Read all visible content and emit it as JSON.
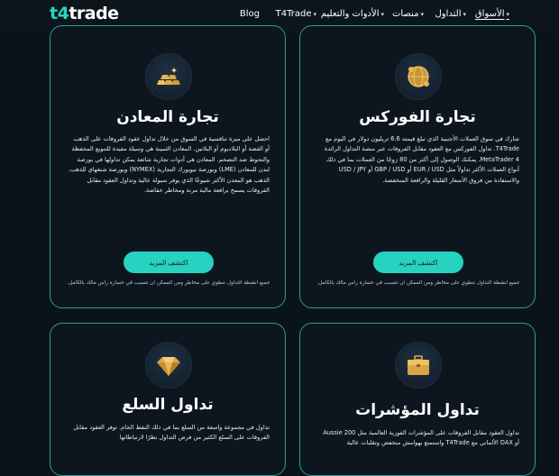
{
  "brand": {
    "logo_prefix": "t4",
    "logo_suffix": "trade"
  },
  "nav": {
    "items": [
      {
        "label": "الأسواق",
        "has_caret": true,
        "active": true
      },
      {
        "label": "التداول",
        "has_caret": true,
        "active": false
      },
      {
        "label": "منصات",
        "has_caret": true,
        "active": false
      },
      {
        "label": "الأدوات والتعليم",
        "has_caret": true,
        "active": false
      },
      {
        "label": "T4Trade",
        "has_caret": true,
        "active": false
      },
      {
        "label": "Blog",
        "has_caret": false,
        "active": false
      }
    ]
  },
  "cards": {
    "forex": {
      "icon": "globe-coins-icon",
      "title": "تجارة الفوركس",
      "description": "شارك في سوق العملات الأجنبية الذي تبلغ قيمته 6.6 تريليون دولار في اليوم مع T4Trade. تداول الفوركس مع العقود مقابل الفروقات عبر منصة التداول الرائدة MetaTrader 4. يمكنك الوصول إلى أكثر من 80 زوجًا من العملات بما في ذلك أنواع العملات الأكثر تداولاً مثل EUR / USD أو GBP / USD أو USD / JPY والاستفادة من فروق الأسعار القليلة والرافعة المنخفضة.",
      "button": "اكتشف المزيد",
      "risk": "جميع أنشطة التداول تنطوي على مخاطر ومن الممكن أن تتسبب في خسارة رأس مالك بالكامل."
    },
    "metals": {
      "icon": "gold-bars-icon",
      "title": "تجارة المعادن",
      "description": "احصل على ميزة تنافسية في السوق من خلال تداول عقود الفروقات على الذهب أو الفضة أو البلاديوم أو البلاتين. المعادن الثمينة هي وسيلة مفيدة للتنويع المحفظة والتحوط ضد التضخم. المعادن هي أدوات تجارية شائعة يمكن تداولها في بورصة لندن للمعادن (LME) وبورصة نيويورك التجارية (NYMEX) وبورصة شنغهاي للذهب. الذهب هو المعدن الأكثر شيوعًا الذي يوفر سيولة عالية وتداول العقود مقابل الفروقات يسمح برافعة مالية مرنة ومخاطر خفاضة.",
      "button": "اكتشف المزيد",
      "risk": "جميع أنشطة التداول تنطوي على مخاطر ومن الممكن أن تتسبب في خسارة رأس مالك بالكامل."
    },
    "indices": {
      "icon": "briefcase-icon",
      "title": "تداول المؤشرات",
      "description": "تداول العقود مقابل الفروقات على المؤشرات الفورية العالمية مثل Aussie 200 أو DAX الألماني مع T4Trade واستمتع بهوامش منخفض وتقلبات عالية"
    },
    "commodities": {
      "icon": "diamond-icon",
      "title": "تداول السلع",
      "description": "تداول في مجموعة واسعة من السلع بما في ذلك النفط الخام. توفر العقود مقابل الفروقات على السلع الكثير من فرص التداول نظرًا لارتباطاتها"
    }
  },
  "colors": {
    "background": "#0b131a",
    "card_border": "#25a093",
    "accent": "#27d2c0"
  }
}
